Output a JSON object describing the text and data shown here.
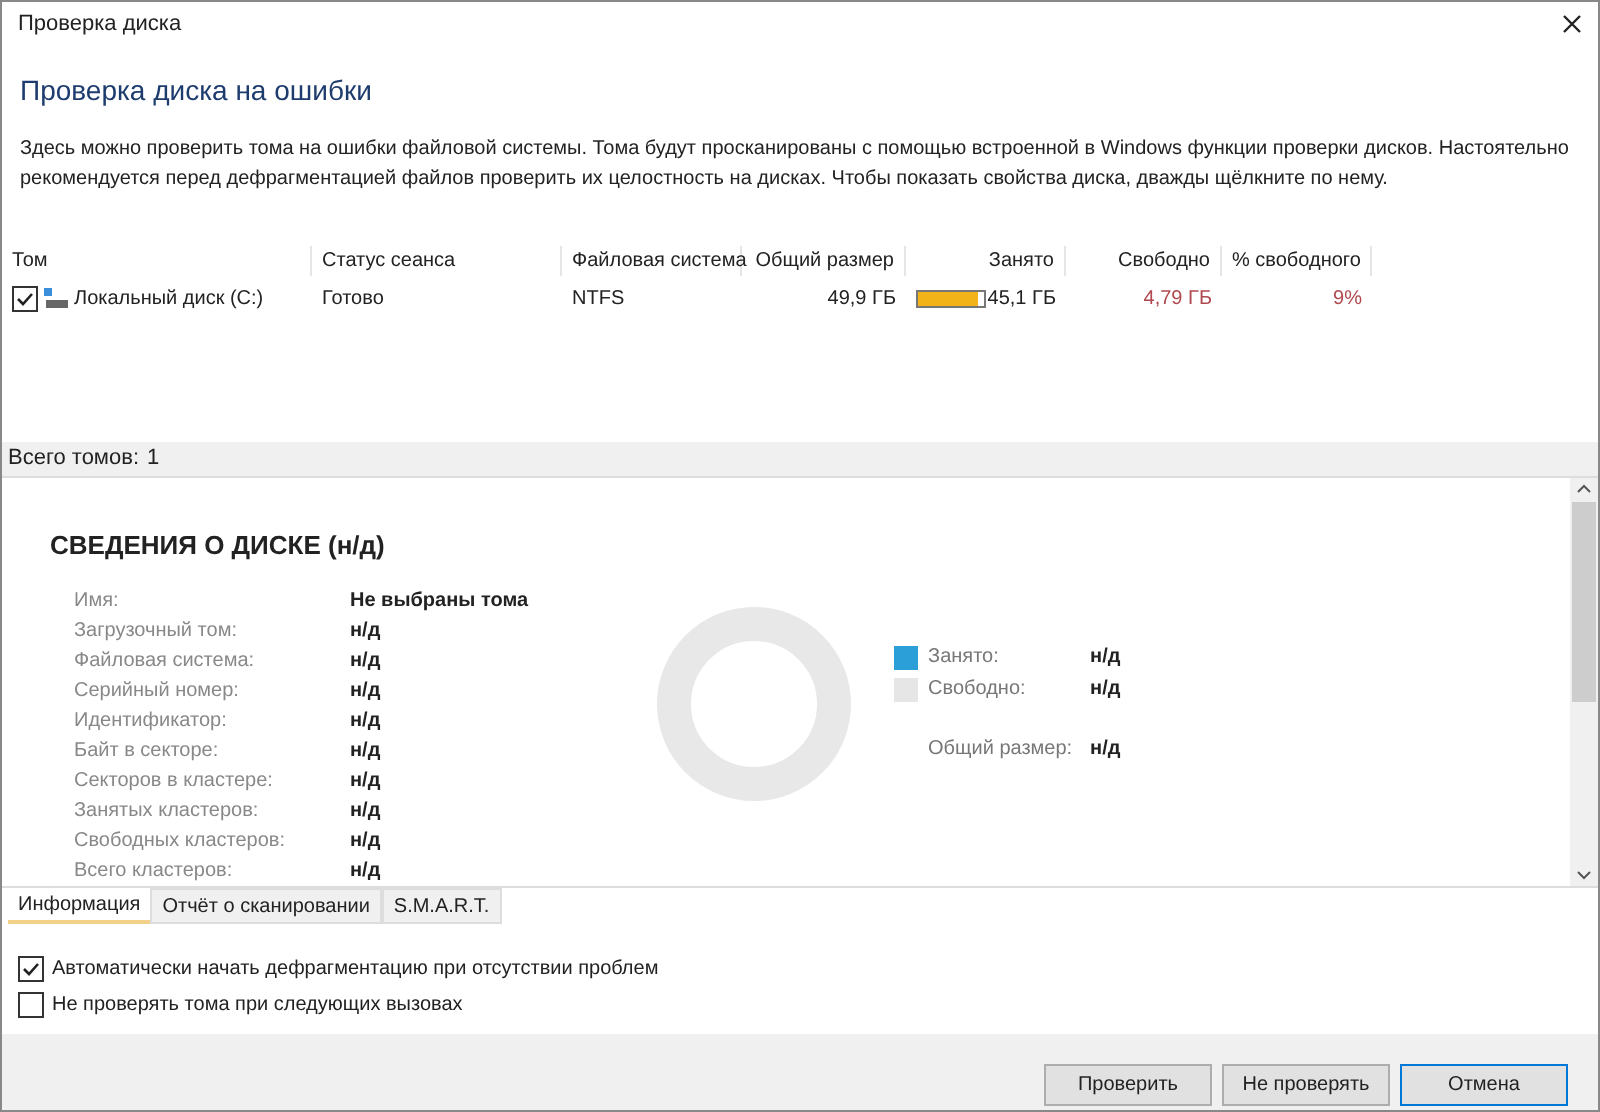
{
  "window": {
    "title": "Проверка диска"
  },
  "heading": "Проверка диска на ошибки",
  "description": "Здесь можно проверить тома на ошибки файловой системы. Тома будут просканированы с помощью встроенной в Windows функции проверки дисков. Настоятельно рекомендуется перед дефрагментацией файлов проверить их целостность на дисках. Чтобы показать свойства диска, дважды щёлкните по нему.",
  "table": {
    "columns": [
      "Том",
      "Статус сеанса",
      "Файловая система",
      "Общий размер",
      "Занято",
      "Свободно",
      "% свободного"
    ],
    "rows": [
      {
        "checked": true,
        "volume": "Локальный диск (C:)",
        "status": "Готово",
        "fs": "NTFS",
        "total": "49,9 ГБ",
        "used": "45,1 ГБ",
        "level": 0.9,
        "free": "4,79 ГБ",
        "free_pct": "9%"
      }
    ]
  },
  "status_bar": {
    "label": "Всего томов:",
    "value": "1"
  },
  "details": {
    "title": "СВЕДЕНИЯ О ДИСКЕ (н/д)",
    "fields": [
      {
        "label": "Имя:",
        "value": "Не выбраны тома"
      },
      {
        "label": "Загрузочный том:",
        "value": "н/д"
      },
      {
        "label": "Файловая система:",
        "value": "н/д"
      },
      {
        "label": "Серийный номер:",
        "value": "н/д"
      },
      {
        "label": "Идентификатор:",
        "value": "н/д"
      },
      {
        "label": "Байт в секторе:",
        "value": "н/д"
      },
      {
        "label": "Секторов в кластере:",
        "value": "н/д"
      },
      {
        "label": "Занятых кластеров:",
        "value": "н/д"
      },
      {
        "label": "Свободных кластеров:",
        "value": "н/д"
      },
      {
        "label": "Всего кластеров:",
        "value": "н/д"
      }
    ],
    "legend": [
      {
        "label": "Занято:",
        "value": "н/д",
        "color": "#2a9fd8"
      },
      {
        "label": "Свободно:",
        "value": "н/д",
        "color": "#e6e6e6"
      }
    ],
    "total": {
      "label": "Общий размер:",
      "value": "н/д"
    }
  },
  "tabs": [
    {
      "label": "Информация",
      "selected": true
    },
    {
      "label": "Отчёт о сканировании",
      "selected": false
    },
    {
      "label": "S.M.A.R.T.",
      "selected": false
    }
  ],
  "options": [
    {
      "label": "Автоматически начать дефрагментацию при отсутствии проблем",
      "checked": true
    },
    {
      "label": "Не проверять тома при следующих вызовах",
      "checked": false
    }
  ],
  "buttons": [
    "Проверить",
    "Не проверять",
    "Отмена"
  ]
}
